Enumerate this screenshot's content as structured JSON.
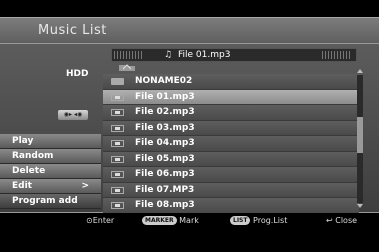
{
  "header": {
    "title": "Music List"
  },
  "source": {
    "label": "HDD",
    "rec_badge": "◉▸ ◂◉"
  },
  "now_playing": {
    "track": "File 01.mp3"
  },
  "menu": {
    "items": [
      {
        "label": "Play"
      },
      {
        "label": "Random"
      },
      {
        "label": "Delete"
      },
      {
        "label": "Edit",
        "arrow": ">"
      },
      {
        "label": "Program add"
      }
    ]
  },
  "files": {
    "rows": [
      {
        "name": "NONAME02",
        "type": "folder"
      },
      {
        "name": "File 01.mp3",
        "type": "file",
        "highlighted": true
      },
      {
        "name": "File 02.mp3",
        "type": "file"
      },
      {
        "name": "File 03.mp3",
        "type": "file"
      },
      {
        "name": "File 04.mp3",
        "type": "file"
      },
      {
        "name": "File 05.mp3",
        "type": "file"
      },
      {
        "name": "File 06.mp3",
        "type": "file"
      },
      {
        "name": "File 07.MP3",
        "type": "file"
      },
      {
        "name": "File 08.mp3",
        "type": "file"
      }
    ]
  },
  "footer": {
    "enter": "Enter",
    "marker_btn": "MARKER",
    "mark": "Mark",
    "list_btn": "LIST",
    "prog_list": "Prog.List",
    "close": "Close"
  }
}
